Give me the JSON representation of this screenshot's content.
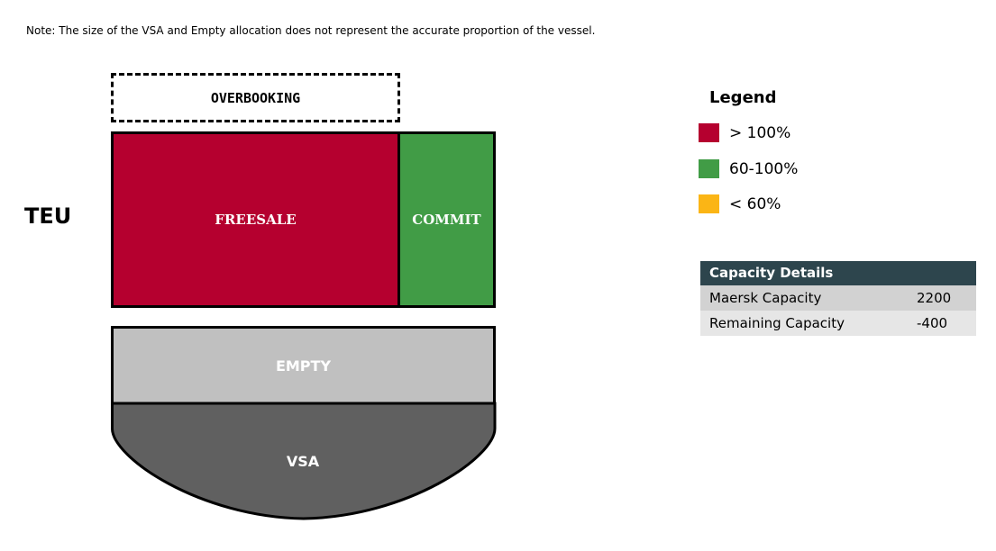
{
  "note": "Note: The size of the VSA and Empty allocation does not represent the accurate proportion of the vessel.",
  "unit_label": "TEU",
  "blocks": {
    "overbooking": "OVERBOOKING",
    "freesale": "FREESALE",
    "commit": "COMMIT",
    "empty": "EMPTY",
    "vsa": "VSA"
  },
  "colors": {
    "freesale": "#b5002f",
    "commit": "#419c46",
    "empty": "#c0c0c0",
    "vsa": "#606060",
    "table_header": "#2d454d"
  },
  "legend": {
    "title": "Legend",
    "items": [
      {
        "label": "> 100%",
        "color": "#b5002f"
      },
      {
        "label": "60-100%",
        "color": "#419c46"
      },
      {
        "label": "< 60%",
        "color": "#fbb515"
      }
    ]
  },
  "capacity_details": {
    "title": "Capacity Details",
    "rows": [
      {
        "label": "Maersk Capacity",
        "value": "2200"
      },
      {
        "label": "Remaining Capacity",
        "value": "-400"
      }
    ]
  }
}
